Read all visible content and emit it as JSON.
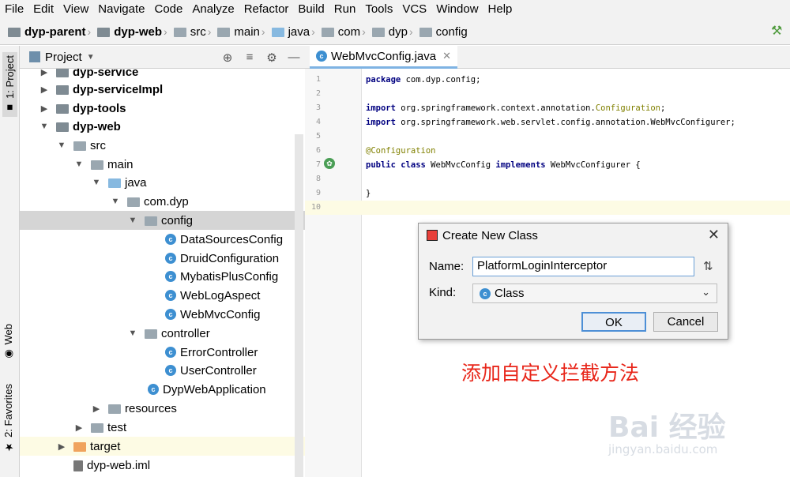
{
  "menu": [
    "File",
    "Edit",
    "View",
    "Navigate",
    "Code",
    "Analyze",
    "Refactor",
    "Build",
    "Run",
    "Tools",
    "VCS",
    "Window",
    "Help"
  ],
  "breadcrumbs": [
    "dyp-parent",
    "dyp-web",
    "src",
    "main",
    "java",
    "com",
    "dyp",
    "config"
  ],
  "left_strip": {
    "project_tab": "1: Project",
    "web_tab": "Web",
    "favorites_tab": "2: Favorites"
  },
  "panel": {
    "title": "Project"
  },
  "tree": [
    {
      "label": "dyp-service",
      "bold": true
    },
    {
      "label": "dyp-serviceImpl",
      "bold": true
    },
    {
      "label": "dyp-tools",
      "bold": true
    },
    {
      "label": "dyp-web",
      "bold": true
    },
    {
      "label": "src"
    },
    {
      "label": "main"
    },
    {
      "label": "java"
    },
    {
      "label": "com.dyp"
    },
    {
      "label": "config"
    },
    {
      "label": "DataSourcesConfig"
    },
    {
      "label": "DruidConfiguration"
    },
    {
      "label": "MybatisPlusConfig"
    },
    {
      "label": "WebLogAspect"
    },
    {
      "label": "WebMvcConfig"
    },
    {
      "label": "controller"
    },
    {
      "label": "ErrorController"
    },
    {
      "label": "UserController"
    },
    {
      "label": "DypWebApplication"
    },
    {
      "label": "resources"
    },
    {
      "label": "test"
    },
    {
      "label": "target"
    },
    {
      "label": "dyp-web.iml"
    }
  ],
  "editor": {
    "tab": "WebMvcConfig.java",
    "line_numbers": [
      "1",
      "2",
      "3",
      "4",
      "5",
      "6",
      "7",
      "8",
      "9",
      "10"
    ],
    "lines": {
      "l1a": "package",
      "l1b": " com.dyp.config;",
      "l3a": "import",
      "l3b": " org.springframework.context.annotation.",
      "l3c": "Configuration",
      "l3d": ";",
      "l4a": "import",
      "l4b": " org.springframework.web.servlet.config.annotation.WebMvcConfigurer;",
      "l6": "@Configuration",
      "l7a": "public class",
      "l7b": " WebMvcConfig ",
      "l7c": "implements",
      "l7d": " WebMvcConfigurer {",
      "l9": "}"
    }
  },
  "dialog": {
    "title": "Create New Class",
    "name_label": "Name:",
    "name_value": "PlatformLoginInterceptor",
    "kind_label": "Kind:",
    "kind_value": "Class",
    "ok": "OK",
    "cancel": "Cancel"
  },
  "annotation_text": "添加自定义拦截方法",
  "watermark": {
    "brand": "Bai 经验",
    "url": "jingyan.baidu.com"
  }
}
